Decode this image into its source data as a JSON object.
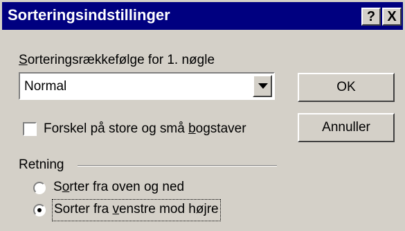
{
  "dialog": {
    "title": "Sorteringsindstillinger",
    "help_label": "?",
    "close_label": "X"
  },
  "order": {
    "label_prefix": "S",
    "label_rest": "orteringsrækkefølge for 1. nøgle",
    "selected_value": "Normal"
  },
  "buttons": {
    "ok_label": "OK",
    "cancel_label": "Annuller"
  },
  "case_sensitive": {
    "label_before": "Forskel på store og små ",
    "label_mnemonic": "b",
    "label_after": "ogstaver",
    "checked": false
  },
  "direction": {
    "group_label": "Retning",
    "option1_prefix": "S",
    "option1_mnemonic": "o",
    "option1_rest": "rter fra oven og ned",
    "option2_before": "Sorter fra ",
    "option2_mnemonic": "v",
    "option2_after": "enstre mod højre",
    "selected": 2
  },
  "colors": {
    "title_bar": "#000080",
    "face": "#d4d0c8"
  }
}
